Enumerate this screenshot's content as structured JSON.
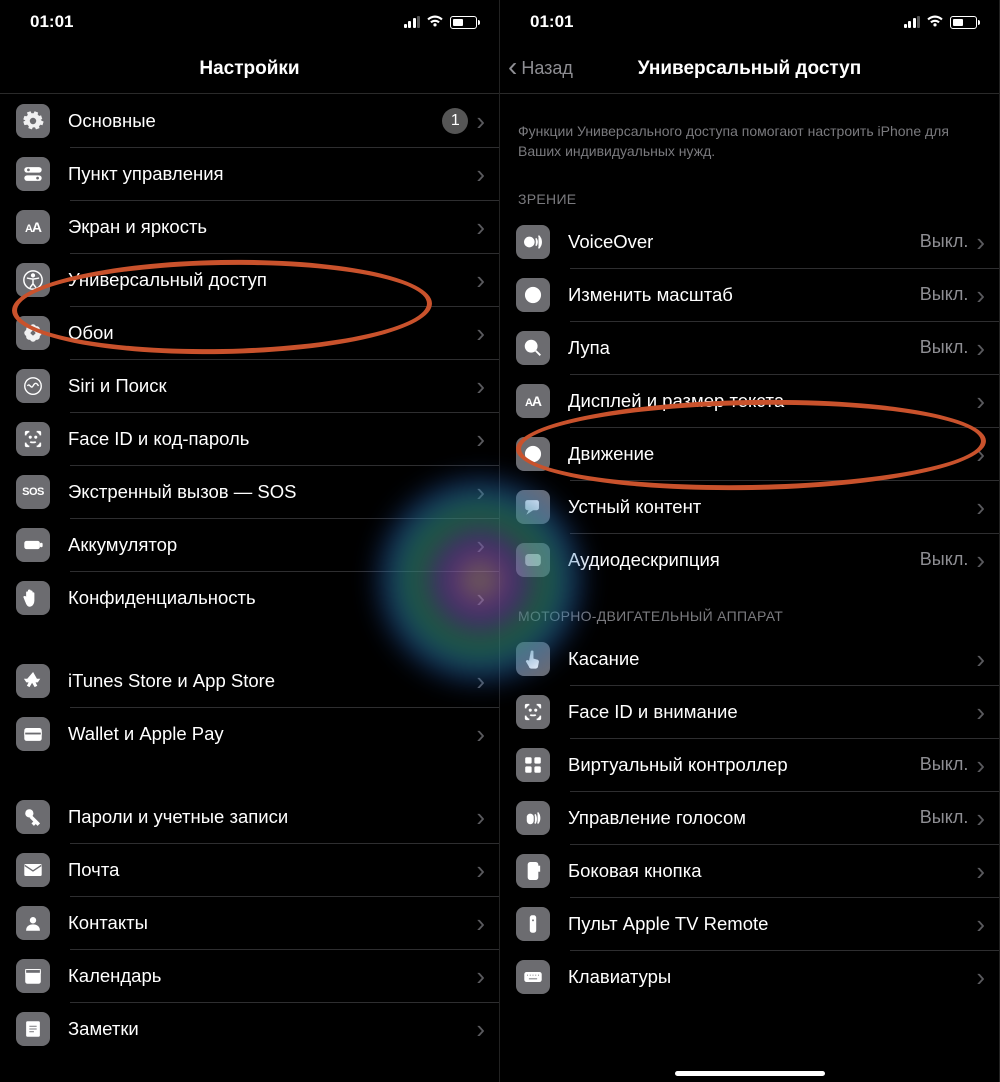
{
  "status": {
    "time": "01:01",
    "battery_pct": 40
  },
  "left": {
    "nav_title": "Настройки",
    "groups": [
      {
        "rows": [
          {
            "icon": "gear",
            "label": "Основные",
            "badge": "1"
          },
          {
            "icon": "switches",
            "label": "Пункт управления"
          },
          {
            "icon": "AA",
            "label": "Экран и яркость"
          },
          {
            "icon": "access",
            "label": "Универсальный доступ"
          },
          {
            "icon": "flower",
            "label": "Обои"
          },
          {
            "icon": "siri",
            "label": "Siri и Поиск"
          },
          {
            "icon": "faceid",
            "label": "Face ID и код-пароль"
          },
          {
            "icon": "sos",
            "label": "Экстренный вызов — SOS"
          },
          {
            "icon": "battery",
            "label": "Аккумулятор"
          },
          {
            "icon": "hand",
            "label": "Конфиденциальность"
          }
        ]
      },
      {
        "rows": [
          {
            "icon": "appstore",
            "label": "iTunes Store и App Store"
          },
          {
            "icon": "wallet",
            "label": "Wallet и Apple Pay"
          }
        ]
      },
      {
        "rows": [
          {
            "icon": "key",
            "label": "Пароли и учетные записи"
          },
          {
            "icon": "mail",
            "label": "Почта"
          },
          {
            "icon": "contact",
            "label": "Контакты"
          },
          {
            "icon": "calendar",
            "label": "Календарь"
          },
          {
            "icon": "notes",
            "label": "Заметки"
          }
        ]
      }
    ]
  },
  "right": {
    "back_label": "Назад",
    "nav_title": "Универсальный доступ",
    "description": "Функции Универсального доступа помогают настроить iPhone для Ваших индивидуальных нужд.",
    "sections": [
      {
        "header": "ЗРЕНИЕ",
        "rows": [
          {
            "icon": "voiceover",
            "label": "VoiceOver",
            "value": "Выкл."
          },
          {
            "icon": "zoom",
            "label": "Изменить масштаб",
            "value": "Выкл."
          },
          {
            "icon": "magnifier",
            "label": "Лупа",
            "value": "Выкл."
          },
          {
            "icon": "AA",
            "label": "Дисплей и размер текста"
          },
          {
            "icon": "motion",
            "label": "Движение"
          },
          {
            "icon": "speech",
            "label": "Устный контент"
          },
          {
            "icon": "audiodesc",
            "label": "Аудиодескрипция",
            "value": "Выкл."
          }
        ]
      },
      {
        "header": "МОТОРНО-ДВИГАТЕЛЬНЫЙ АППАРАТ",
        "rows": [
          {
            "icon": "touch",
            "label": "Касание"
          },
          {
            "icon": "faceid",
            "label": "Face ID и внимание"
          },
          {
            "icon": "grid",
            "label": "Виртуальный контроллер",
            "value": "Выкл."
          },
          {
            "icon": "voice",
            "label": "Управление голосом",
            "value": "Выкл."
          },
          {
            "icon": "sidebtn",
            "label": "Боковая кнопка"
          },
          {
            "icon": "remote",
            "label": "Пульт Apple TV Remote"
          },
          {
            "icon": "keyboard",
            "label": "Клавиатуры"
          }
        ]
      }
    ]
  }
}
